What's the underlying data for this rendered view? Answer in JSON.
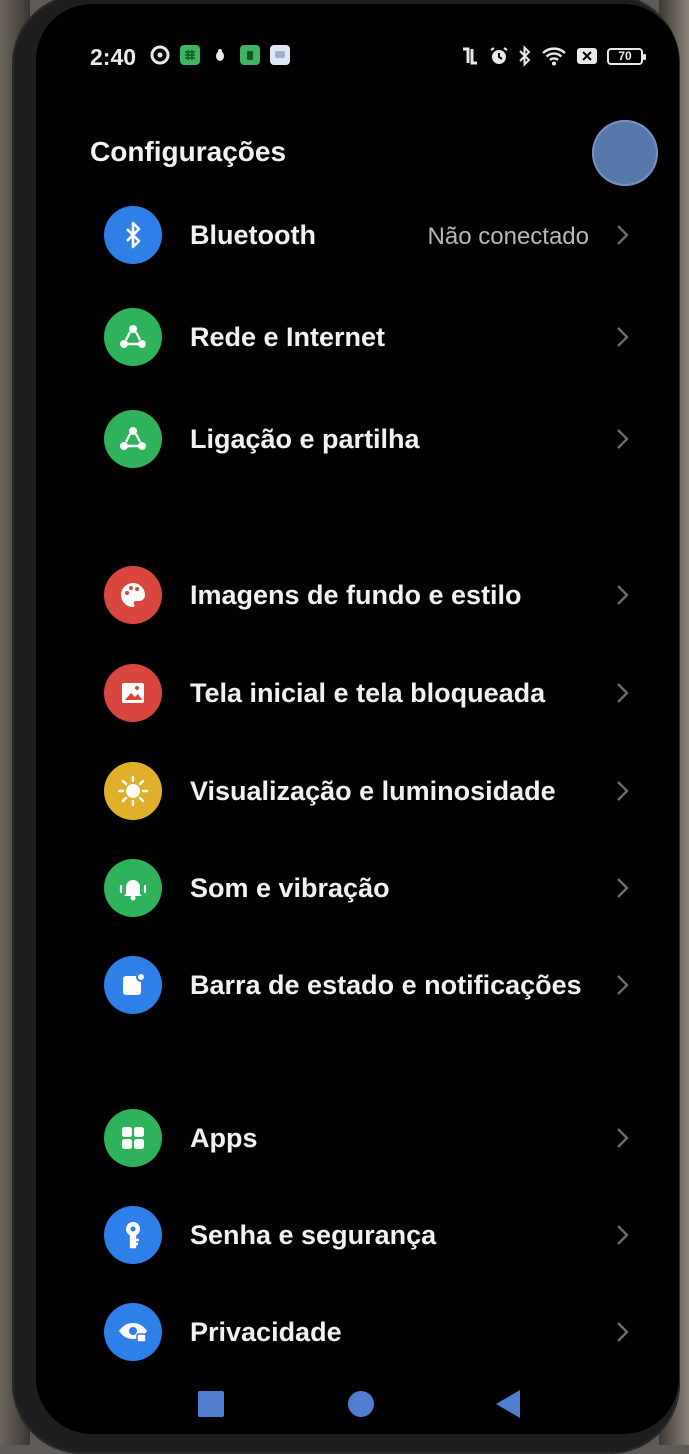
{
  "status_bar": {
    "time": "2:40",
    "battery": "70",
    "left_icons": [
      "gear-badge-icon",
      "calendar-app-icon",
      "bug-icon",
      "green-app-icon",
      "chat-app-icon"
    ],
    "right_icons": [
      "nfc-icon",
      "alarm-icon",
      "bluetooth-icon",
      "wifi-icon",
      "sim-off-icon"
    ]
  },
  "header": {
    "title": "Configurações"
  },
  "groups": [
    [
      {
        "label": "Bluetooth",
        "value": "Não conectado",
        "icon": "bluetooth-icon",
        "color": "#2f7fe8"
      },
      {
        "label": "Rede e Internet",
        "value": "",
        "icon": "network-icon",
        "color": "#2fb35a"
      },
      {
        "label": "Ligação e partilha",
        "value": "",
        "icon": "connection-sharing-icon",
        "color": "#2fb35a"
      }
    ],
    [
      {
        "label": "Imagens de fundo e estilo",
        "value": "",
        "icon": "palette-icon",
        "color": "#d9463e"
      },
      {
        "label": "Tela inicial e tela bloqueada",
        "value": "",
        "icon": "image-icon",
        "color": "#d9463e"
      },
      {
        "label": "Visualização e luminosidade",
        "value": "",
        "icon": "brightness-icon",
        "color": "#e0b02a"
      },
      {
        "label": "Som e vibração",
        "value": "",
        "icon": "bell-icon",
        "color": "#2fb35a"
      },
      {
        "label": "Barra de estado e notificações",
        "value": "",
        "icon": "notification-icon",
        "color": "#2f7fe8"
      }
    ],
    [
      {
        "label": "Apps",
        "value": "",
        "icon": "apps-grid-icon",
        "color": "#2fb35a"
      },
      {
        "label": "Senha e segurança",
        "value": "",
        "icon": "key-icon",
        "color": "#2f7fe8"
      },
      {
        "label": "Privacidade",
        "value": "",
        "icon": "privacy-eye-icon",
        "color": "#2f7fe8"
      }
    ]
  ],
  "nav_bar": {
    "recent": "recent-apps",
    "home": "home",
    "back": "back"
  }
}
